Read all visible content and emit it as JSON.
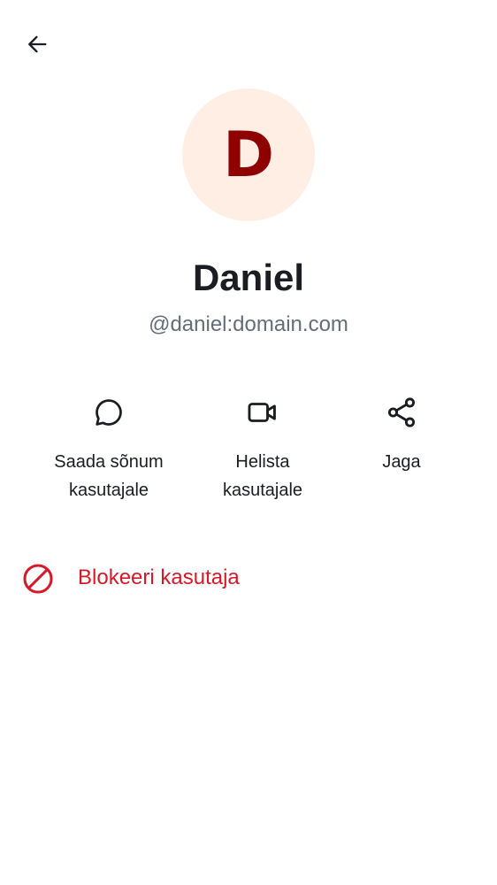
{
  "avatar": {
    "letter": "D",
    "background": "#ffeee4",
    "letter_color": "#8f0000"
  },
  "profile": {
    "display_name": "Daniel",
    "user_id": "@daniel:domain.com"
  },
  "actions": [
    {
      "id": "message",
      "icon": "chat-bubble-icon",
      "label": "Saada sõnum\nkasutajale"
    },
    {
      "id": "call",
      "icon": "video-call-icon",
      "label": "Helista\nkasutajale"
    },
    {
      "id": "share",
      "icon": "share-icon",
      "label": "Jaga"
    }
  ],
  "block": {
    "icon": "block-icon",
    "label": "Blokeeri kasutaja",
    "color": "#d51928"
  },
  "navigation": {
    "back_icon": "back-arrow-icon"
  },
  "colors": {
    "text_primary": "#1b1d22",
    "text_secondary": "#656d77",
    "critical": "#d51928"
  }
}
